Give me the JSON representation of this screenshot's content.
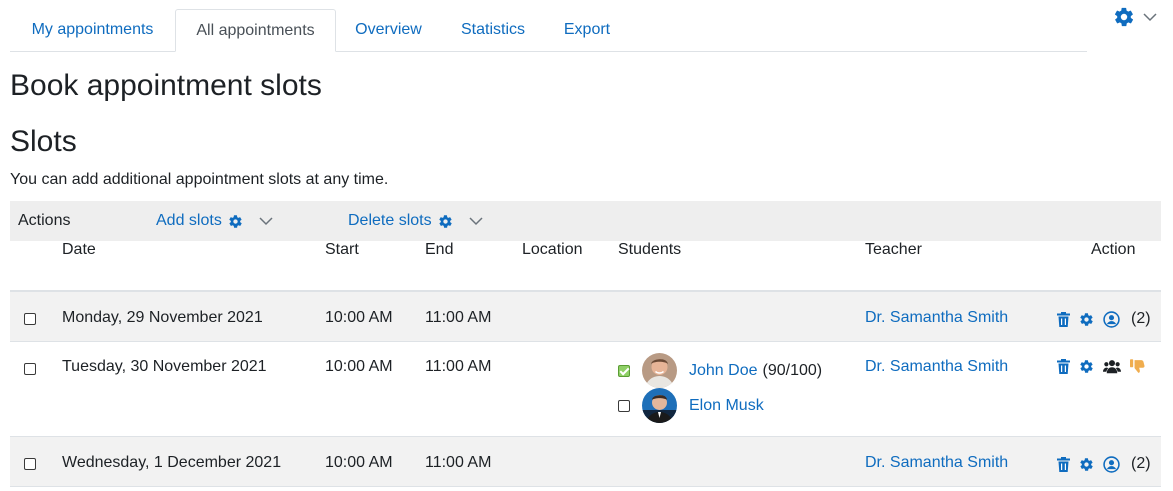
{
  "tabs": [
    {
      "label": "My appointments"
    },
    {
      "label": "All appointments"
    },
    {
      "label": "Overview"
    },
    {
      "label": "Statistics"
    },
    {
      "label": "Export"
    }
  ],
  "page_title": "Book appointment slots",
  "section_title": "Slots",
  "intro": "You can add additional appointment slots at any time.",
  "actions_bar": {
    "label": "Actions",
    "add_slots": "Add slots",
    "delete_slots": "Delete slots"
  },
  "table": {
    "headers": {
      "date": "Date",
      "start": "Start",
      "end": "End",
      "location": "Location",
      "students": "Students",
      "teacher": "Teacher",
      "action": "Action"
    },
    "rows": [
      {
        "date": "Monday, 29 November 2021",
        "start": "10:00 AM",
        "end": "11:00 AM",
        "location": "",
        "teacher": "Dr. Samantha Smith",
        "count": "(2)"
      },
      {
        "date": "Tuesday, 30 November 2021",
        "start": "10:00 AM",
        "end": "11:00 AM",
        "location": "",
        "teacher": "Dr. Samantha Smith",
        "students": [
          {
            "name": "John Doe",
            "grade": "(90/100)",
            "checked": true
          },
          {
            "name": "Elon Musk",
            "grade": "",
            "checked": false
          }
        ]
      },
      {
        "date": "Wednesday, 1 December 2021",
        "start": "10:00 AM",
        "end": "11:00 AM",
        "location": "",
        "teacher": "Dr. Samantha Smith",
        "count": "(2)"
      }
    ]
  },
  "colors": {
    "link": "#0f6cbf",
    "stripe": "#f2f2f2",
    "actions_bar": "#eeeeee",
    "checked": "#8fd066"
  },
  "icons": [
    "gear-icon",
    "chevron-down-icon",
    "trash-icon",
    "user-circle-icon",
    "users-icon",
    "thumbs-down-icon"
  ]
}
